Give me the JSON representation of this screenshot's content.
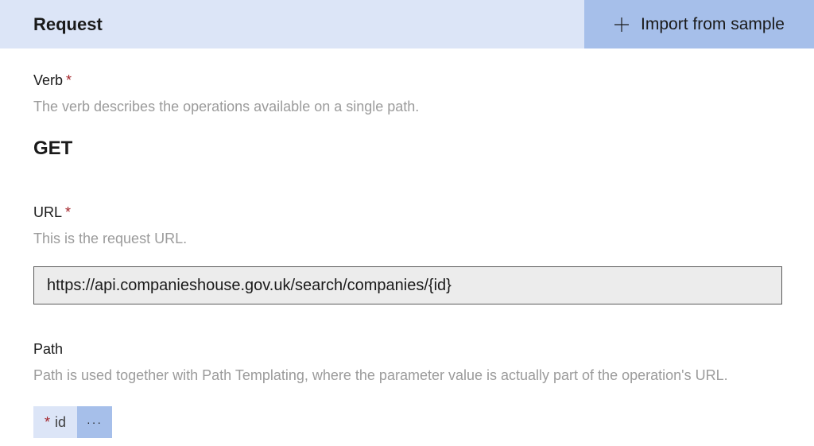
{
  "header": {
    "title": "Request",
    "import_label": "Import from sample"
  },
  "verb": {
    "label": "Verb",
    "description": "The verb describes the operations available on a single path.",
    "value": "GET"
  },
  "url": {
    "label": "URL",
    "description": "This is the request URL.",
    "value": "https://api.companieshouse.gov.uk/search/companies/{id}"
  },
  "path": {
    "label": "Path",
    "description": "Path is used together with Path Templating, where the parameter value is actually part of the operation's URL.",
    "param_name": "id",
    "more_label": "···"
  },
  "star": "*"
}
